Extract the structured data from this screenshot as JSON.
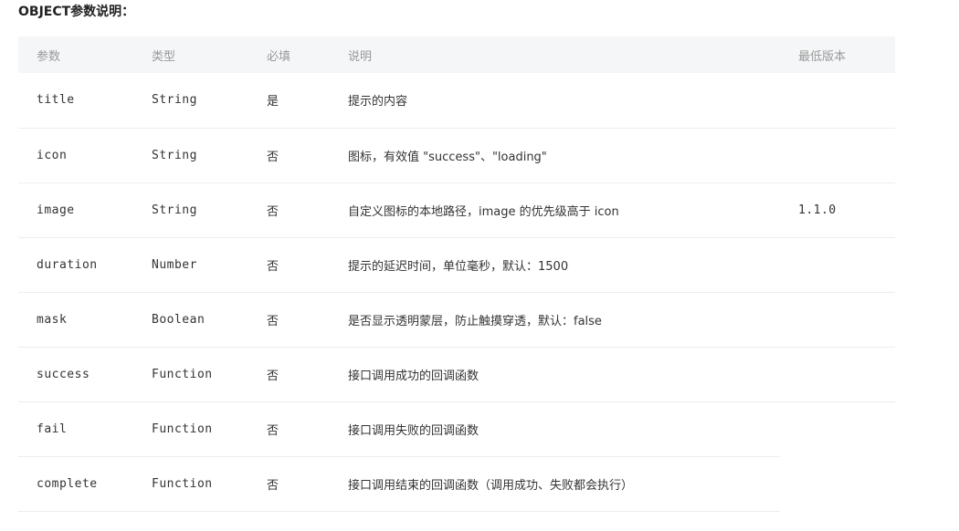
{
  "section_title": "OBJECT参数说明：",
  "headers": {
    "param": "参数",
    "type": "类型",
    "required": "必填",
    "desc": "说明",
    "version": "最低版本"
  },
  "rows": [
    {
      "param": "title",
      "type": "String",
      "required": "是",
      "desc": "提示的内容",
      "version": ""
    },
    {
      "param": "icon",
      "type": "String",
      "required": "否",
      "desc": "图标，有效值 \"success\"、\"loading\"",
      "version": ""
    },
    {
      "param": "image",
      "type": "String",
      "required": "否",
      "desc": "自定义图标的本地路径，image 的优先级高于 icon",
      "version": "1.1.0"
    },
    {
      "param": "duration",
      "type": "Number",
      "required": "否",
      "desc": "提示的延迟时间，单位毫秒，默认：1500",
      "version": ""
    },
    {
      "param": "mask",
      "type": "Boolean",
      "required": "否",
      "desc": "是否显示透明蒙层，防止触摸穿透，默认：false",
      "version": ""
    },
    {
      "param": "success",
      "type": "Function",
      "required": "否",
      "desc": "接口调用成功的回调函数",
      "version": ""
    },
    {
      "param": "fail",
      "type": "Function",
      "required": "否",
      "desc": "接口调用失败的回调函数",
      "version": ""
    },
    {
      "param": "complete",
      "type": "Function",
      "required": "否",
      "desc": "接口调用结束的回调函数（调用成功、失败都会执行）",
      "version": ""
    }
  ],
  "colors": {
    "header_bg": "#f5f6f7",
    "header_text": "#999999",
    "row_border": "#ebedf0",
    "version_link": "#4a6fa5"
  }
}
